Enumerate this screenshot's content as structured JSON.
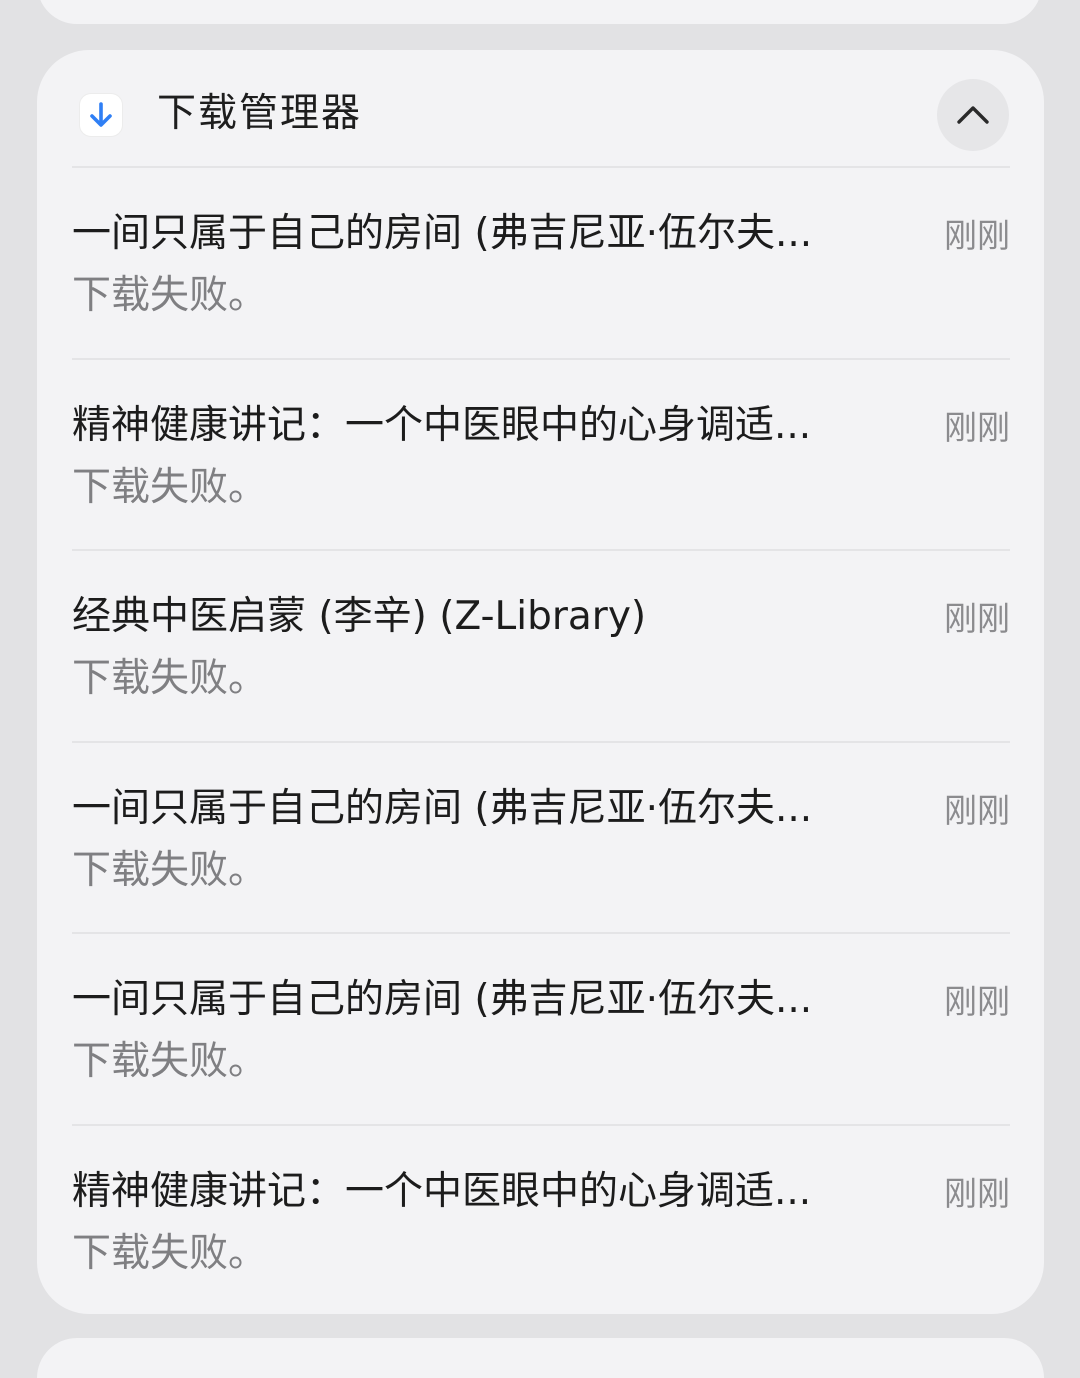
{
  "panel": {
    "title": "下载管理器",
    "icon": "download-arrow-icon",
    "collapse_icon": "chevron-up-icon",
    "accent_color": "#2f7ff5"
  },
  "items": [
    {
      "title": "一间只属于自己的房间 (弗吉尼亚·伍尔夫...",
      "status": "下载失败。",
      "time": "刚刚"
    },
    {
      "title": "精神健康讲记：一个中医眼中的心身调适...",
      "status": "下载失败。",
      "time": "刚刚"
    },
    {
      "title": "经典中医启蒙 (李辛) (Z-Library)",
      "status": "下载失败。",
      "time": "刚刚"
    },
    {
      "title": "一间只属于自己的房间 (弗吉尼亚·伍尔夫...",
      "status": "下载失败。",
      "time": "刚刚"
    },
    {
      "title": "一间只属于自己的房间 (弗吉尼亚·伍尔夫...",
      "status": "下载失败。",
      "time": "刚刚"
    },
    {
      "title": "精神健康讲记：一个中医眼中的心身调适...",
      "status": "下载失败。",
      "time": "刚刚"
    }
  ]
}
